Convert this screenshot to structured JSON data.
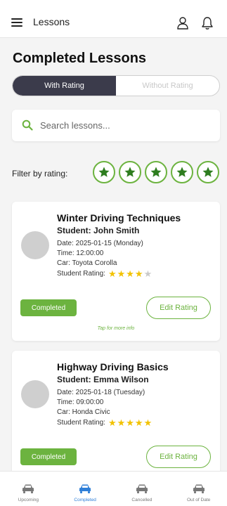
{
  "header": {
    "title": "Lessons"
  },
  "page": {
    "title": "Completed Lessons"
  },
  "segments": [
    {
      "label": "With Rating",
      "active": true
    },
    {
      "label": "Without Rating",
      "active": false
    }
  ],
  "search": {
    "placeholder": "Search lessons..."
  },
  "filter": {
    "label": "Filter by rating:",
    "star_count": 5
  },
  "lessons": [
    {
      "title": "Winter Driving Techniques",
      "student": "Student: John Smith",
      "date": "Date: 2025-01-15 (Monday)",
      "time": "Time: 12:00:00",
      "car": "Car: Toyota Corolla",
      "rating_label": "Student Rating:",
      "rating": 4,
      "status": "Completed",
      "edit_label": "Edit Rating",
      "tap_info": "Tap for more info"
    },
    {
      "title": "Highway Driving Basics",
      "student": "Student: Emma Wilson",
      "date": "Date: 2025-01-18 (Tuesday)",
      "time": "Time: 09:00:00",
      "car": "Car: Honda Civic",
      "rating_label": "Student Rating:",
      "rating": 5,
      "status": "Completed",
      "edit_label": "Edit Rating"
    }
  ],
  "bottom_nav": [
    {
      "label": "Upcoming",
      "icon": "car-icon",
      "active": false
    },
    {
      "label": "Completed",
      "icon": "car-icon",
      "active": true
    },
    {
      "label": "Cancelled",
      "icon": "car-icon",
      "active": false
    },
    {
      "label": "Out of Date",
      "icon": "car-icon",
      "active": false
    }
  ],
  "colors": {
    "accent_green": "#6cb33f",
    "active_segment": "#3b3b4b",
    "active_nav": "#2f7fd8",
    "star_filled": "#f2c200",
    "star_empty": "#c9c9c9"
  }
}
